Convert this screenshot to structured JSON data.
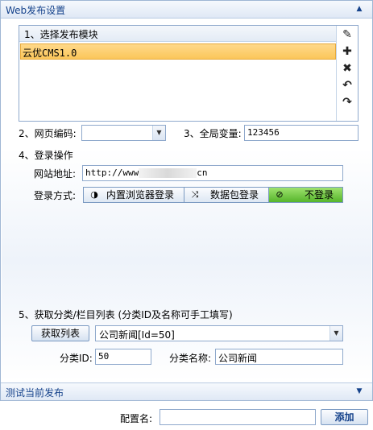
{
  "panel": {
    "title": "Web发布设置",
    "collapse_glyph": "▲"
  },
  "module_section": {
    "header": "1、选择发布模块",
    "items": [
      "云优CMS1.0"
    ],
    "tools": [
      {
        "name": "pencil-icon",
        "glyph": "✎"
      },
      {
        "name": "plus-icon",
        "glyph": "✚"
      },
      {
        "name": "delete-icon",
        "glyph": "✖"
      },
      {
        "name": "undo-icon",
        "glyph": "↶"
      },
      {
        "name": "redo-icon",
        "glyph": "↷"
      }
    ]
  },
  "encoding": {
    "label": "2、网页编码:",
    "value": ""
  },
  "global_var": {
    "label": "3、全局变量:",
    "value": "123456"
  },
  "login": {
    "title": "4、登录操作",
    "site_label": "网站地址:",
    "site_prefix": "http://www",
    "site_suffix": "cn",
    "method_label": "登录方式:",
    "methods": [
      {
        "label": "内置浏览器登录",
        "icon": "◑"
      },
      {
        "label": "数据包登录",
        "icon": "⤨"
      },
      {
        "label": "不登录",
        "icon": "⊘"
      }
    ],
    "active_method": 2
  },
  "category": {
    "title": "5、获取分类/栏目列表",
    "hint": "(分类ID及名称可手工填写)",
    "fetch_button": "获取列表",
    "selected": "公司新闻[Id=50]",
    "id_label": "分类ID:",
    "id_value": "50",
    "name_label": "分类名称:",
    "name_value": "公司新闻"
  },
  "footer": {
    "title": "测试当前发布",
    "expand_glyph": "▼"
  },
  "config": {
    "label": "配置名:",
    "value": "",
    "add_button": "添加"
  },
  "colors": {
    "header_text": "#15428b",
    "selection": "#fbc65a",
    "active_button": "#56b52b"
  }
}
